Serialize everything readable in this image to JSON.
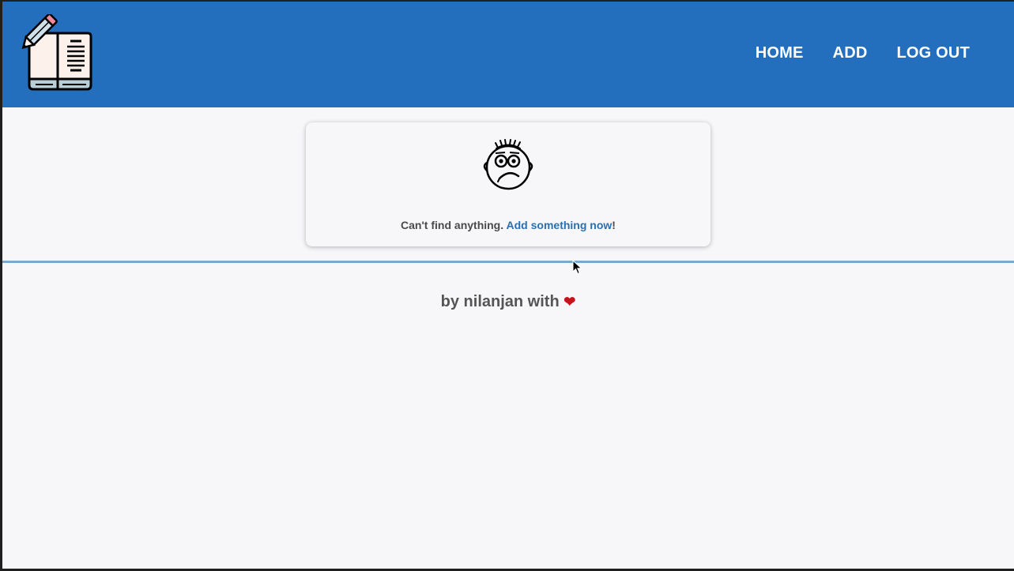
{
  "header": {
    "nav": {
      "home": "HOME",
      "add": "ADD",
      "logout": "LOG OUT"
    }
  },
  "empty_state": {
    "message": "Can't find anything.",
    "link": "Add something now",
    "suffix": "!"
  },
  "footer": {
    "text": "by nilanjan with",
    "heart": "❤"
  },
  "colors": {
    "header_bg": "#236ebd",
    "page_bg": "#f7f6f9",
    "link": "#2a6fb0",
    "heart": "#c8121b"
  },
  "icons": {
    "logo": "book-pencil-logo-icon",
    "empty": "confused-face-icon"
  }
}
